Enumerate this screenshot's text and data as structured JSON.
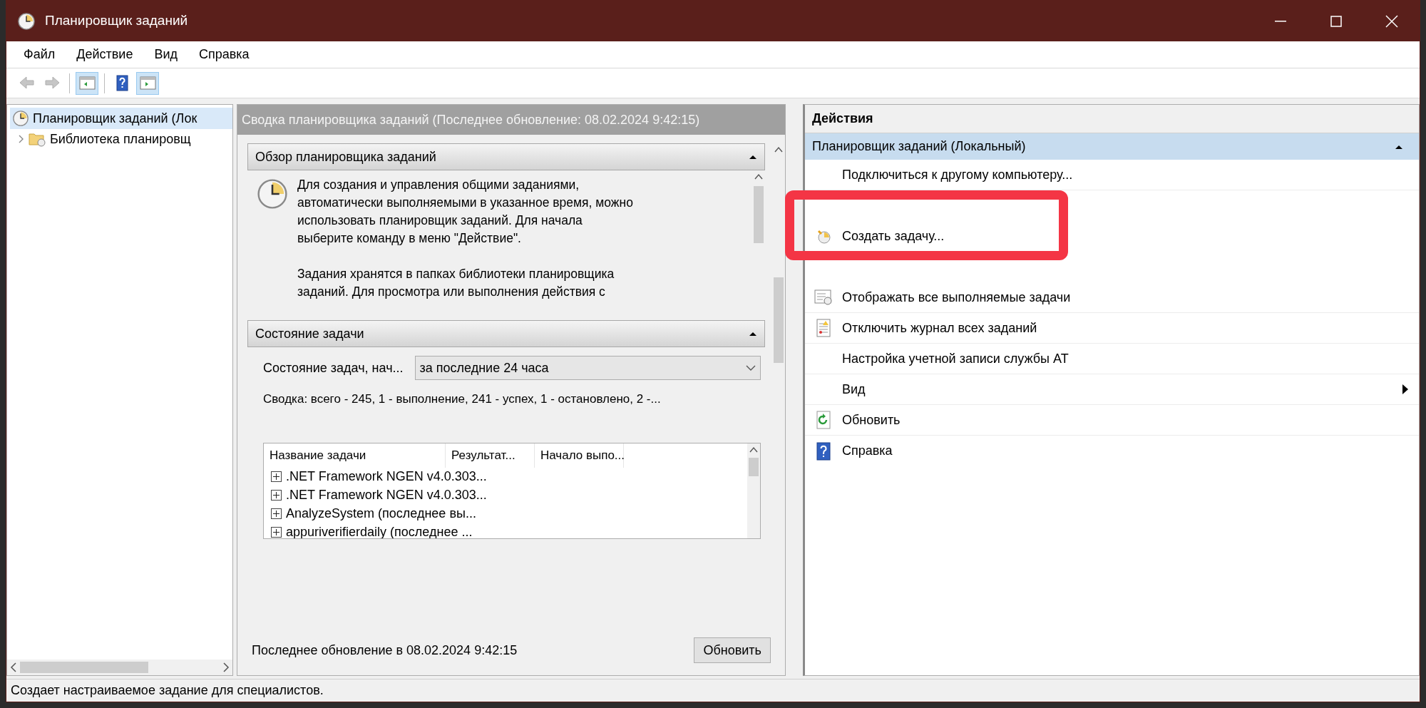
{
  "window": {
    "title": "Планировщик заданий"
  },
  "menu": [
    "Файл",
    "Действие",
    "Вид",
    "Справка"
  ],
  "toolbar": [
    {
      "kind": "back",
      "disabled": true,
      "pressed": false
    },
    {
      "kind": "forward",
      "disabled": true,
      "pressed": false
    },
    {
      "kind": "tree-pane",
      "disabled": false,
      "pressed": true
    },
    {
      "kind": "help",
      "disabled": false,
      "pressed": false
    },
    {
      "kind": "action-pane",
      "disabled": false,
      "pressed": true
    }
  ],
  "tree": [
    {
      "label": "Планировщик заданий (Лок",
      "selected": true,
      "children": [
        {
          "label": "Библиотека планировщ",
          "selected": false,
          "expanded": false
        }
      ]
    }
  ],
  "summary": {
    "header": "Сводка планировщика заданий (Последнее обновление: 08.02.2024 9:42:15)",
    "overview": {
      "title": "Обзор планировщика заданий",
      "expanded": true,
      "paragraphs": [
        "Для создания и управления общими заданиями, автоматически выполняемыми в указанное время, можно использовать планировщик заданий. Для начала выберите команду в меню \"Действие\".",
        "Задания хранятся в папках библиотеки планировщика заданий. Для просмотра или выполнения действия с"
      ]
    },
    "status": {
      "title": "Состояние задачи",
      "expanded": true,
      "filter_label": "Состояние задач, нач...",
      "filter_value": "за последние 24 часа",
      "totals": "Сводка: всего - 245, 1 - выполнение, 241 - успех, 1 - остановлено, 2 -...",
      "columns": [
        "Название задачи",
        "Результат...",
        "Начало выпо..."
      ],
      "rows": [
        {
          "name": ".NET Framework NGEN v4.0.303...",
          "expanded": false
        },
        {
          "name": ".NET Framework NGEN v4.0.303...",
          "expanded": false
        },
        {
          "name": "AnalyzeSystem (последнее вы...",
          "expanded": false
        },
        {
          "name": "appuriverifierdaily (последнее ...",
          "expanded": false
        }
      ]
    },
    "footer": {
      "text": "Последнее обновление в 08.02.2024 9:42:15",
      "button": "Обновить"
    }
  },
  "actions": {
    "title": "Действия",
    "section": {
      "label": "Планировщик заданий (Локальный)",
      "expanded": true
    },
    "items": [
      {
        "label": "Подключиться к другому компьютеру...",
        "kind": "plain"
      }
    ],
    "highlight": {
      "color": "#f43545",
      "items": [
        {
          "label": "Создать задачу...",
          "kind": "task"
        }
      ]
    },
    "items_after": [
      {
        "label": "Отображать все выполняемые задачи",
        "kind": "running"
      },
      {
        "label": "Отключить журнал всех заданий",
        "kind": "journal"
      },
      {
        "label": "Настройка учетной записи службы AT",
        "kind": "plain"
      },
      {
        "label": "Вид",
        "kind": "submenu"
      },
      {
        "label": "Обновить",
        "kind": "refresh"
      },
      {
        "label": "Справка",
        "kind": "help"
      }
    ]
  },
  "status_bar": "Создает настраиваемое задание для специалистов."
}
